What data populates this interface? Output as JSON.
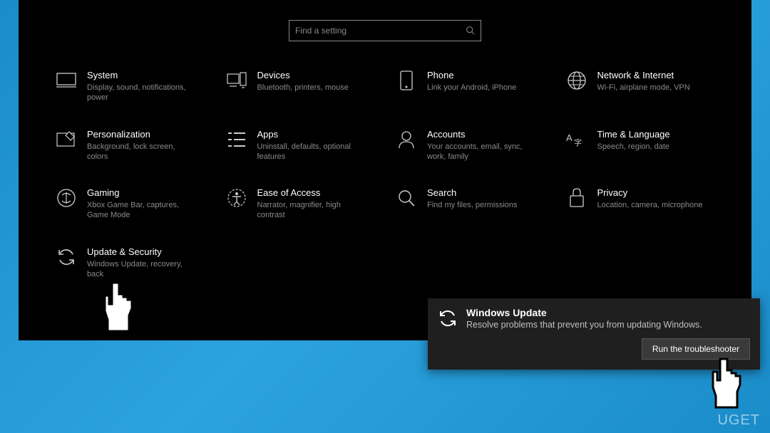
{
  "search": {
    "placeholder": "Find a setting"
  },
  "categories": [
    {
      "title": "System",
      "desc": "Display, sound, notifications, power"
    },
    {
      "title": "Devices",
      "desc": "Bluetooth, printers, mouse"
    },
    {
      "title": "Phone",
      "desc": "Link your Android, iPhone"
    },
    {
      "title": "Network & Internet",
      "desc": "Wi-Fi, airplane mode, VPN"
    },
    {
      "title": "Personalization",
      "desc": "Background, lock screen, colors"
    },
    {
      "title": "Apps",
      "desc": "Uninstall, defaults, optional features"
    },
    {
      "title": "Accounts",
      "desc": "Your accounts, email, sync, work, family"
    },
    {
      "title": "Time & Language",
      "desc": "Speech, region, date"
    },
    {
      "title": "Gaming",
      "desc": "Xbox Game Bar, captures, Game Mode"
    },
    {
      "title": "Ease of Access",
      "desc": "Narrator, magnifier, high contrast"
    },
    {
      "title": "Search",
      "desc": "Find my files, permissions"
    },
    {
      "title": "Privacy",
      "desc": "Location, camera, microphone"
    },
    {
      "title": "Update & Security",
      "desc": "Windows Update, recovery, back"
    }
  ],
  "troubleshoot": {
    "title": "Windows Update",
    "desc": "Resolve problems that prevent you from updating Windows.",
    "button": "Run the troubleshooter"
  },
  "watermark": "UGET"
}
